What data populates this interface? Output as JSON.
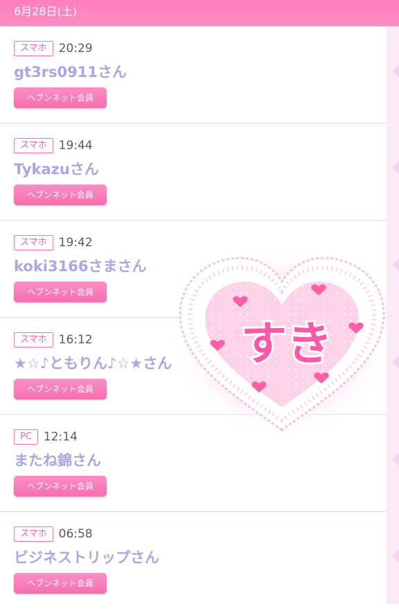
{
  "header": {
    "date": "6月28日(土)"
  },
  "entries": [
    {
      "device": "スマホ",
      "time": "20:29",
      "name": "gt3rs0911さん",
      "badge": "ヘブンネット会員"
    },
    {
      "device": "スマホ",
      "time": "19:44",
      "name": "Tykazuさん",
      "badge": "ヘブンネット会員"
    },
    {
      "device": "スマホ",
      "time": "19:42",
      "name": "koki3166さまさん",
      "badge": "ヘブンネット会員"
    },
    {
      "device": "スマホ",
      "time": "16:12",
      "name": "★☆♪ともりん♪☆★さん",
      "badge": "ヘブンネット会員"
    },
    {
      "device": "PC",
      "time": "12:14",
      "name": "またね錦さん",
      "badge": "ヘブンネット会員"
    },
    {
      "device": "スマホ",
      "time": "06:58",
      "name": "ビジネストリップさん",
      "badge": "ヘブンネット会員"
    }
  ],
  "sticker": {
    "text": "すき",
    "icon": "heart-sticker"
  },
  "colors": {
    "header_bg": "#ff84c0",
    "accent": "#ff5fa7",
    "name": "#a9a6e8",
    "divider": "#f6cfe3"
  }
}
